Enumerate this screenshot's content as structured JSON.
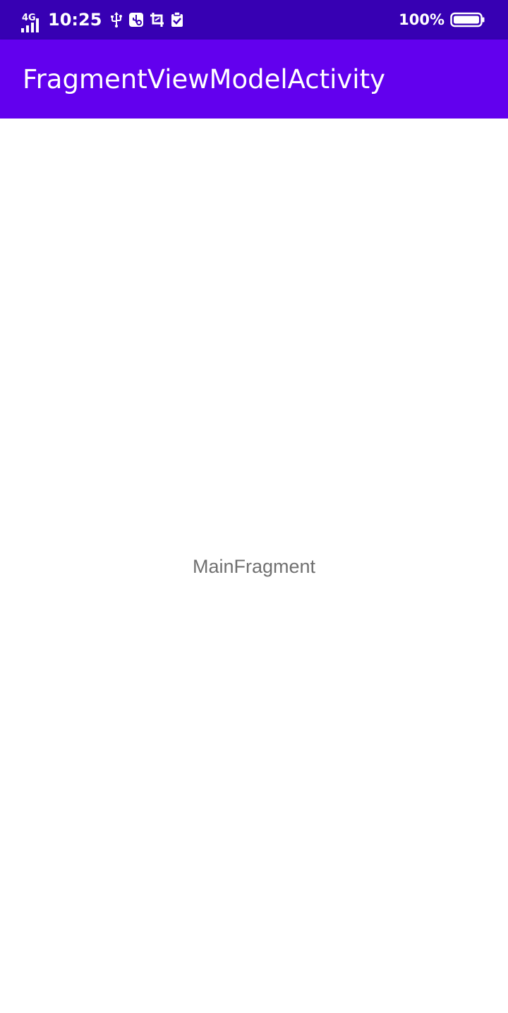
{
  "status_bar": {
    "network_type": "4G",
    "time": "10:25",
    "battery_percent": "100%",
    "battery_level": 1.0,
    "icons": [
      "signal-icon",
      "usb-icon",
      "usb-debug-icon",
      "screenshot-icon",
      "clipboard-check-icon",
      "battery-icon"
    ],
    "background_color": "#3700b3"
  },
  "app_bar": {
    "title": "FragmentViewModelActivity",
    "background_color": "#6200ee"
  },
  "main": {
    "fragment_label": "MainFragment"
  }
}
